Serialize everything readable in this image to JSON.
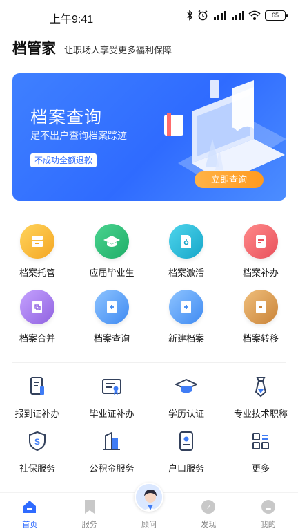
{
  "status_bar": {
    "time": "上午9:41",
    "battery": "65",
    "icons": [
      "bluetooth-icon",
      "alarm-icon",
      "signal-icon",
      "signal-icon",
      "wifi-icon",
      "battery-icon"
    ]
  },
  "header": {
    "title": "档管家",
    "slogan": "让职场人享受更多福利保障"
  },
  "banner": {
    "title": "档案查询",
    "subtitle": "足不出户查询档案踪迹",
    "tag": "不成功全额退款",
    "button": "立即查询"
  },
  "grid_primary": [
    {
      "label": "档案托管",
      "icon": "archive-box-icon",
      "color": "#f7b733"
    },
    {
      "label": "应届毕业生",
      "icon": "graduation-cap-icon",
      "color": "#2ec27e"
    },
    {
      "label": "档案激活",
      "icon": "document-activate-icon",
      "color": "#25b9d8"
    },
    {
      "label": "档案补办",
      "icon": "document-reissue-icon",
      "color": "#f06a6a"
    },
    {
      "label": "档案合并",
      "icon": "document-merge-icon",
      "color": "#a77be8"
    },
    {
      "label": "档案查询",
      "icon": "document-search-icon",
      "color": "#4f97f6"
    },
    {
      "label": "新建档案",
      "icon": "document-new-icon",
      "color": "#4f97f6"
    },
    {
      "label": "档案转移",
      "icon": "document-transfer-icon",
      "color": "#d4964b"
    }
  ],
  "grid_secondary": [
    {
      "label": "报到证补办",
      "icon": "report-certificate-icon"
    },
    {
      "label": "毕业证补办",
      "icon": "diploma-icon"
    },
    {
      "label": "学历认证",
      "icon": "graduation-cap-outline-icon"
    },
    {
      "label": "专业技术职称",
      "icon": "tie-icon"
    },
    {
      "label": "社保服务",
      "icon": "shield-icon"
    },
    {
      "label": "公积金服务",
      "icon": "building-icon"
    },
    {
      "label": "户口服务",
      "icon": "id-card-icon"
    },
    {
      "label": "更多",
      "icon": "grid-more-icon"
    }
  ],
  "bottom_nav": [
    {
      "label": "首页",
      "icon": "home-icon",
      "active": true
    },
    {
      "label": "服务",
      "icon": "bookmark-icon",
      "active": false
    },
    {
      "label": "顾问",
      "icon": "advisor-avatar-icon",
      "active": false
    },
    {
      "label": "发现",
      "icon": "compass-icon",
      "active": false
    },
    {
      "label": "我的",
      "icon": "profile-icon",
      "active": false
    }
  ],
  "colors": {
    "accent": "#2f6bff",
    "banner_button": "#ff9a1f",
    "icon_line_dark": "#33415c",
    "icon_line_blue": "#3f7cf5"
  }
}
